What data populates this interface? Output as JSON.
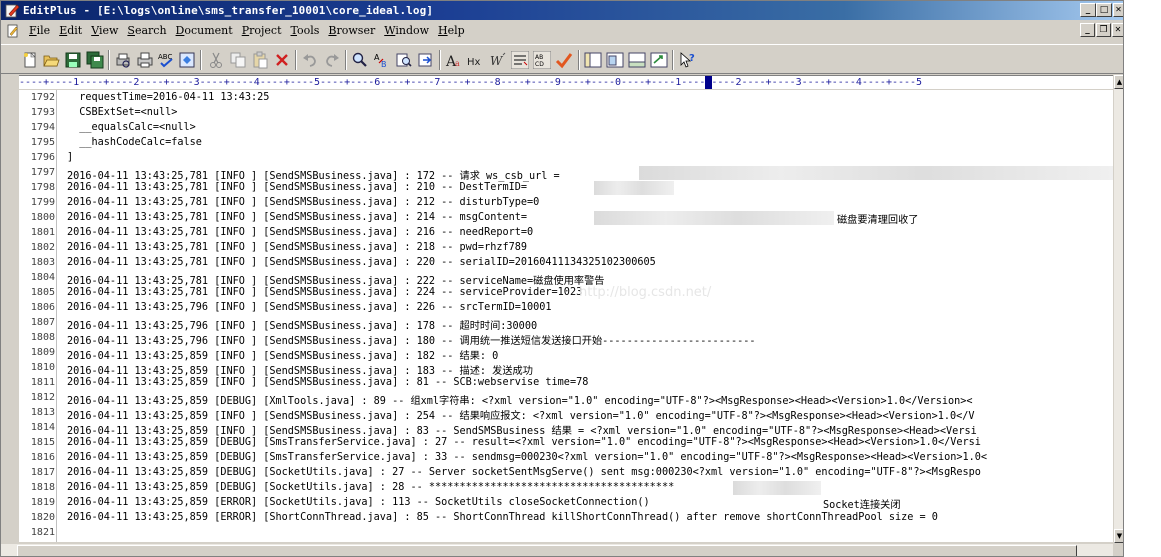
{
  "window": {
    "title": "EditPlus - [E:\\logs\\online\\sms_transfer_10001\\core_ideal.log]",
    "app_icon": "editplus-icon",
    "caption_buttons": [
      "minimize",
      "maximize",
      "close"
    ]
  },
  "menu": {
    "items": [
      "File",
      "Edit",
      "View",
      "Search",
      "Document",
      "Project",
      "Tools",
      "Browser",
      "Window",
      "Help"
    ]
  },
  "toolbar": {
    "icons": [
      "new-icon",
      "open-icon",
      "save-icon",
      "save-all-icon",
      "print-preview-icon",
      "print-icon",
      "spell-check-icon",
      "browser-icon",
      "cut-icon",
      "copy-icon",
      "paste-icon",
      "delete-icon",
      "undo-icon",
      "redo-icon",
      "find-icon",
      "replace-icon",
      "find-in-files-icon",
      "goto-icon",
      "font-icon",
      "hex-icon",
      "word-wrap-icon",
      "ruler-icon",
      "line-number-icon",
      "spell-icon",
      "directory-window-icon",
      "cliptext-window-icon",
      "output-window-icon",
      "full-screen-icon",
      "help-icon"
    ]
  },
  "ruler": {
    "text": "----+----1----+----2----+----3----+----4----+----5----+----6----+----7----+----8----+----9----+----0----+----1----+----2----+----3----+----4----+----5"
  },
  "editor": {
    "lines": [
      {
        "n": "1792",
        "text": "  requestTime=2016-04-11 13:43:25"
      },
      {
        "n": "1793",
        "text": "  CSBExtSet=<null>"
      },
      {
        "n": "1794",
        "text": "  __equalsCalc=<null>"
      },
      {
        "n": "1795",
        "text": "  __hashCodeCalc=false"
      },
      {
        "n": "1796",
        "text": "]"
      },
      {
        "n": "1797",
        "text": "2016-04-11 13:43:25,781 [INFO ] [SendSMSBusiness.java] : 172 -- 请求 ws_csb_url ="
      },
      {
        "n": "1798",
        "text": "2016-04-11 13:43:25,781 [INFO ] [SendSMSBusiness.java] : 210 -- DestTermID="
      },
      {
        "n": "1799",
        "text": "2016-04-11 13:43:25,781 [INFO ] [SendSMSBusiness.java] : 212 -- disturbType=0"
      },
      {
        "n": "1800",
        "text": "2016-04-11 13:43:25,781 [INFO ] [SendSMSBusiness.java] : 214 -- msgContent="
      },
      {
        "n": "1801",
        "text": "2016-04-11 13:43:25,781 [INFO ] [SendSMSBusiness.java] : 216 -- needReport=0"
      },
      {
        "n": "1802",
        "text": "2016-04-11 13:43:25,781 [INFO ] [SendSMSBusiness.java] : 218 -- pwd=rhzf789"
      },
      {
        "n": "1803",
        "text": "2016-04-11 13:43:25,781 [INFO ] [SendSMSBusiness.java] : 220 -- serialID=20160411134325102300605"
      },
      {
        "n": "1804",
        "text": "2016-04-11 13:43:25,781 [INFO ] [SendSMSBusiness.java] : 222 -- serviceName=磁盘使用率警告"
      },
      {
        "n": "1805",
        "text": "2016-04-11 13:43:25,781 [INFO ] [SendSMSBusiness.java] : 224 -- serviceProvider=1023"
      },
      {
        "n": "1806",
        "text": "2016-04-11 13:43:25,796 [INFO ] [SendSMSBusiness.java] : 226 -- srcTermID=10001"
      },
      {
        "n": "1807",
        "text": "2016-04-11 13:43:25,796 [INFO ] [SendSMSBusiness.java] : 178 -- 超时时间:30000"
      },
      {
        "n": "1808",
        "text": "2016-04-11 13:43:25,796 [INFO ] [SendSMSBusiness.java] : 180 -- 调用统一推送短信发送接口开始-------------------------"
      },
      {
        "n": "1809",
        "text": "2016-04-11 13:43:25,859 [INFO ] [SendSMSBusiness.java] : 182 -- 结果: 0"
      },
      {
        "n": "1810",
        "text": "2016-04-11 13:43:25,859 [INFO ] [SendSMSBusiness.java] : 183 -- 描述: 发送成功"
      },
      {
        "n": "1811",
        "text": "2016-04-11 13:43:25,859 [INFO ] [SendSMSBusiness.java] : 81 -- SCB:webservise time=78"
      },
      {
        "n": "1812",
        "text": "2016-04-11 13:43:25,859 [DEBUG] [XmlTools.java] : 89 -- 组xml字符串: <?xml version=\"1.0\" encoding=\"UTF-8\"?><MsgResponse><Head><Version>1.0</Version><"
      },
      {
        "n": "1813",
        "text": "2016-04-11 13:43:25,859 [INFO ] [SendSMSBusiness.java] : 254 -- 结果响应报文: <?xml version=\"1.0\" encoding=\"UTF-8\"?><MsgResponse><Head><Version>1.0</V"
      },
      {
        "n": "1814",
        "text": "2016-04-11 13:43:25,859 [INFO ] [SendSMSBusiness.java] : 83 -- SendSMSBusiness 结果 = <?xml version=\"1.0\" encoding=\"UTF-8\"?><MsgResponse><Head><Versi"
      },
      {
        "n": "1815",
        "text": "2016-04-11 13:43:25,859 [DEBUG] [SmsTransferService.java] : 27 -- result=<?xml version=\"1.0\" encoding=\"UTF-8\"?><MsgResponse><Head><Version>1.0</Versi"
      },
      {
        "n": "1816",
        "text": "2016-04-11 13:43:25,859 [DEBUG] [SmsTransferService.java] : 33 -- sendmsg=000230<?xml version=\"1.0\" encoding=\"UTF-8\"?><MsgResponse><Head><Version>1.0<"
      },
      {
        "n": "1817",
        "text": "2016-04-11 13:43:25,859 [DEBUG] [SocketUtils.java] : 27 -- Server socketSentMsgServe() sent msg:000230<?xml version=\"1.0\" encoding=\"UTF-8\"?><MsgRespo"
      },
      {
        "n": "1818",
        "text": "2016-04-11 13:43:25,859 [DEBUG] [SocketUtils.java] : 28 -- ****************************************"
      },
      {
        "n": "1819",
        "text": "2016-04-11 13:43:25,859 [ERROR] [SocketUtils.java] : 113 -- SocketUtils closeSocketConnection()"
      },
      {
        "n": "1820",
        "text": "2016-04-11 13:43:25,859 [ERROR] [ShortConnThread.java] : 85 -- ShortConnThread killShortConnThread() after remove shortConnThreadPool size = 0"
      },
      {
        "n": "1821",
        "text": ""
      }
    ],
    "fragments": {
      "msg_tail": "磁盘要清理回收了",
      "socket_tail": "Socket连接关闭"
    },
    "watermark": "http://blog.csdn.net/"
  },
  "colors": {
    "title_start": "#0a246a",
    "title_end": "#a6caf0",
    "chrome": "#d4d0c8",
    "ruler_text": "#1c1c9c"
  }
}
